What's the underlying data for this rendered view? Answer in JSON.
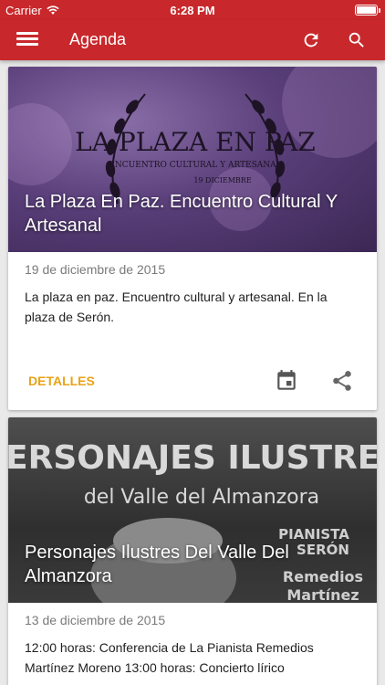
{
  "status_bar": {
    "carrier": "Carrier",
    "time": "6:28 PM"
  },
  "app_bar": {
    "title": "Agenda",
    "menu_icon": "hamburger-menu-icon",
    "refresh_icon": "refresh-icon",
    "search_icon": "search-icon"
  },
  "colors": {
    "primary": "#c8282c",
    "accent": "#e8a317",
    "card_bg": "#ffffff",
    "page_bg": "#e9e9e9"
  },
  "events": [
    {
      "title": "La Plaza En Paz. Encuentro Cultural Y Artesanal",
      "date": "19 de diciembre de 2015",
      "description": "La plaza en paz. Encuentro cultural y artesanal. En la plaza de Serón.",
      "poster_text": {
        "line1": "LA PLAZA EN PAZ",
        "line2": "ENCUENTRO CULTURAL Y ARTESANAL",
        "line3": "19 DICIEMBRE"
      },
      "details_label": "DETALLES",
      "calendar_icon": "calendar-icon",
      "share_icon": "share-icon"
    },
    {
      "title": "Personajes Ilustres Del Valle Del Almanzora",
      "date": "13 de diciembre de 2015",
      "description": "12:00 horas: Conferencia de La Pianista Remedios Martínez Moreno 13:00 horas: Concierto lírico",
      "poster_text": {
        "line1": "PERSONAJES ILUSTRES",
        "line2": "del Valle del Almanzora",
        "line3": "PIANISTA",
        "line4": "SERÓN",
        "line5": "Remedios",
        "line6": "Martínez"
      }
    }
  ]
}
